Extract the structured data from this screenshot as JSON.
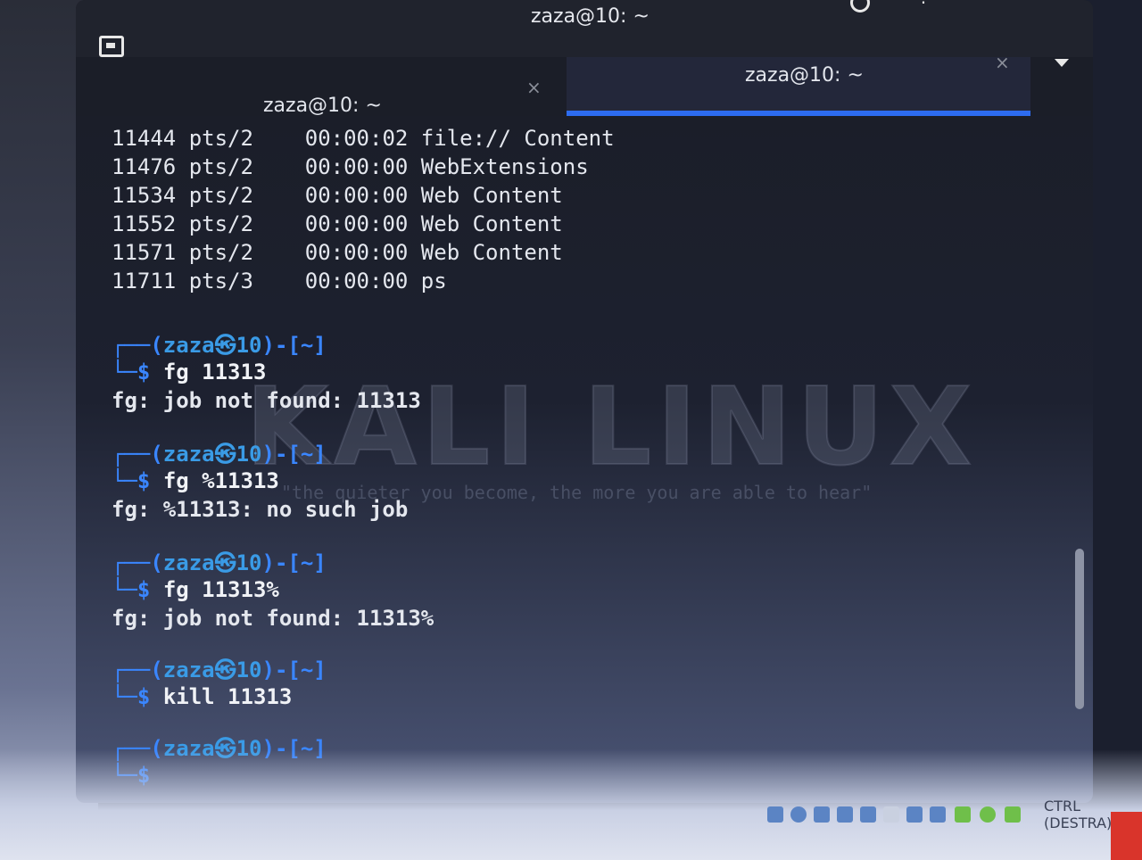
{
  "window": {
    "title": "zaza@10: ~"
  },
  "tabs": [
    {
      "label": "zaza@10: ~",
      "close": "×",
      "active": false
    },
    {
      "label": "zaza@10: ~",
      "close": "×",
      "active": true
    }
  ],
  "ps_rows": [
    {
      "pid": "11444",
      "tty": "pts/2",
      "time": "00:00:02",
      "cmd": "file:// Content"
    },
    {
      "pid": "11476",
      "tty": "pts/2",
      "time": "00:00:00",
      "cmd": "WebExtensions"
    },
    {
      "pid": "11534",
      "tty": "pts/2",
      "time": "00:00:00",
      "cmd": "Web Content"
    },
    {
      "pid": "11552",
      "tty": "pts/2",
      "time": "00:00:00",
      "cmd": "Web Content"
    },
    {
      "pid": "11571",
      "tty": "pts/2",
      "time": "00:00:00",
      "cmd": "Web Content"
    },
    {
      "pid": "11711",
      "tty": "pts/3",
      "time": "00:00:00",
      "cmd": "ps"
    }
  ],
  "prompt": {
    "head": "┌──(",
    "user": "zaza㉿10",
    "tail": ")-[~]",
    "corner": "└─",
    "dollar": "$"
  },
  "sessions": [
    {
      "command": "fg 11313",
      "output": "fg: job not found: 11313"
    },
    {
      "command": "fg %11313",
      "output": "fg: %11313: no such job"
    },
    {
      "command": "fg 11313%",
      "output": "fg: job not found: 11313%"
    },
    {
      "command": "kill 11313",
      "output": ""
    },
    {
      "command": "",
      "output": ""
    }
  ],
  "watermark": {
    "logo": "KALI LINUX",
    "quote": "\"the quieter you become, the more you are able to hear\""
  },
  "host": {
    "key_label": "CTRL (DESTRA)"
  }
}
